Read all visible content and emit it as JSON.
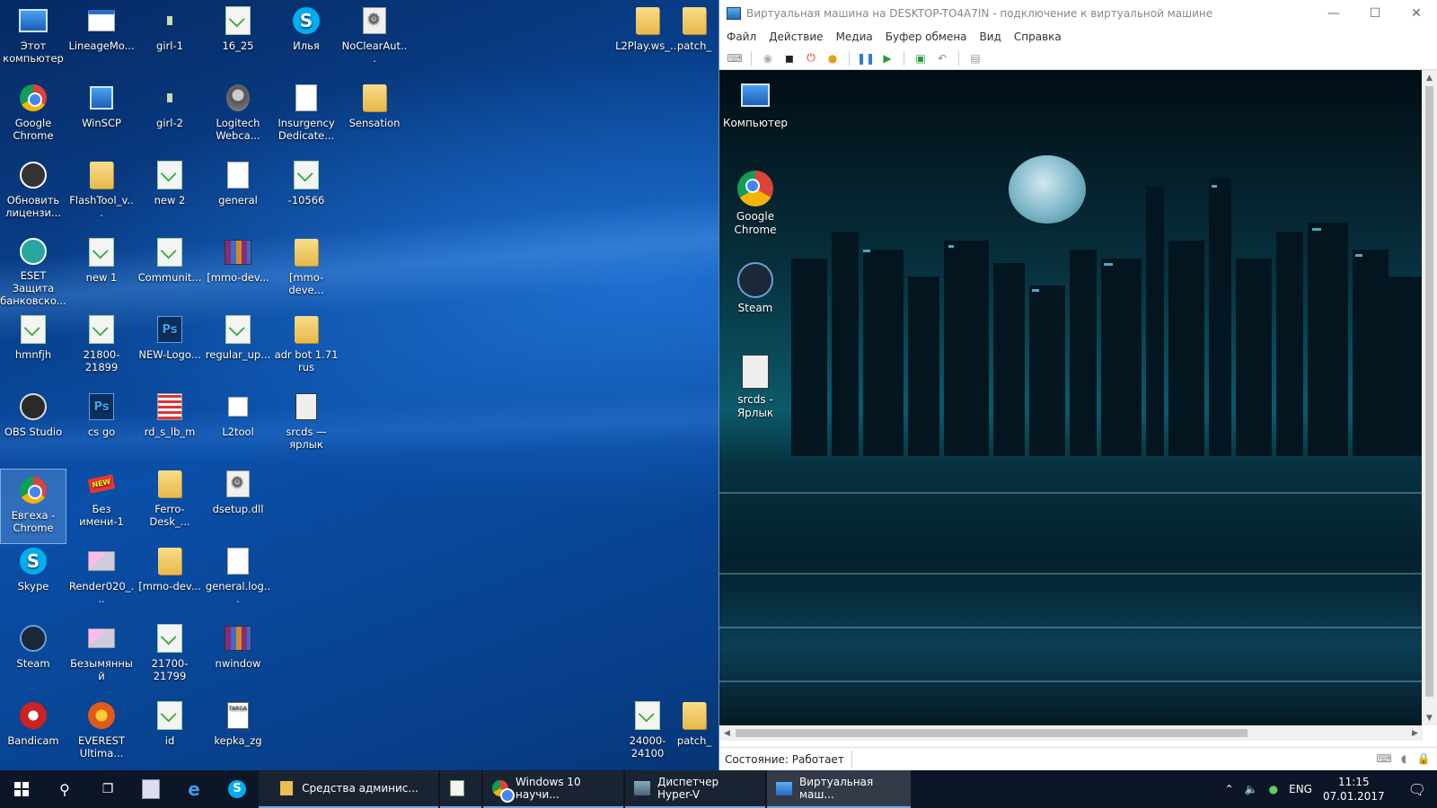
{
  "desktop": {
    "icons": [
      {
        "label": "Этот компьютер",
        "icon": "computer-icon"
      },
      {
        "label": "LineageMo...",
        "icon": "window-icon"
      },
      {
        "label": "girl-1",
        "icon": "image-icon"
      },
      {
        "label": "16_25",
        "icon": "notepadpp-icon"
      },
      {
        "label": "Илья",
        "icon": "skype-icon"
      },
      {
        "label": "NoClearAut...",
        "icon": "settings-file-icon"
      },
      {
        "label": "Google Chrome",
        "icon": "chrome-icon"
      },
      {
        "label": "WinSCP",
        "icon": "winscp-icon"
      },
      {
        "label": "girl-2",
        "icon": "image-icon"
      },
      {
        "label": "Logitech Webca...",
        "icon": "webcam-icon"
      },
      {
        "label": "Insurgency Dedicate...",
        "icon": "document-icon"
      },
      {
        "label": "Sensation",
        "icon": "folder-icon"
      },
      {
        "label": "Обновить лицензи...",
        "icon": "update-icon"
      },
      {
        "label": "FlashTool_v...",
        "icon": "folder-icon"
      },
      {
        "label": "new 2",
        "icon": "notepadpp-icon"
      },
      {
        "label": "general",
        "icon": "document-icon"
      },
      {
        "label": "-10566",
        "icon": "notepadpp-icon"
      },
      {
        "label": "ESET Защита банковско...",
        "icon": "eset-icon"
      },
      {
        "label": "new 1",
        "icon": "notepadpp-icon"
      },
      {
        "label": "Communit...",
        "icon": "notepadpp-icon"
      },
      {
        "label": "[mmo-dev...",
        "icon": "winrar-icon"
      },
      {
        "label": "[mmo-deve...",
        "icon": "folder-icon"
      },
      {
        "label": "hmnfjh",
        "icon": "notepadpp-icon"
      },
      {
        "label": "21800-21899",
        "icon": "notepadpp-icon"
      },
      {
        "label": "NEW-Logo...",
        "icon": "photoshop-icon"
      },
      {
        "label": "regular_up...",
        "icon": "notepadpp-icon"
      },
      {
        "label": "adr bot 1.71 rus",
        "icon": "folder-icon"
      },
      {
        "label": "OBS Studio",
        "icon": "obs-icon"
      },
      {
        "label": "cs go",
        "icon": "photoshop-icon"
      },
      {
        "label": "rd_s_lb_m",
        "icon": "image-icon"
      },
      {
        "label": "L2tool",
        "icon": "shortcut-icon"
      },
      {
        "label": "srcds — ярлык",
        "icon": "srcds-icon"
      },
      {
        "label": "Евгеха - Chrome",
        "icon": "chrome-icon"
      },
      {
        "label": "Без имени-1",
        "icon": "new-badge-icon"
      },
      {
        "label": "Ferro-Desk_...",
        "icon": "folder-icon"
      },
      {
        "label": "dsetup.dll",
        "icon": "settings-file-icon"
      },
      {
        "label": "Skype",
        "icon": "skype-icon"
      },
      {
        "label": "Render020_...",
        "icon": "image-icon"
      },
      {
        "label": "[mmo-dev...",
        "icon": "folder-icon"
      },
      {
        "label": "general.log...",
        "icon": "document-icon"
      },
      {
        "label": "Steam",
        "icon": "steam-icon"
      },
      {
        "label": "Безымянный",
        "icon": "image-icon"
      },
      {
        "label": "21700-21799",
        "icon": "notepadpp-icon"
      },
      {
        "label": "nwindow",
        "icon": "winrar-icon"
      },
      {
        "label": "Bandicam",
        "icon": "bandicam-icon"
      },
      {
        "label": "EVEREST Ultima...",
        "icon": "everest-icon"
      },
      {
        "label": "id",
        "icon": "notepadpp-icon"
      },
      {
        "label": "kepka_zg",
        "icon": "targa-icon"
      },
      {
        "label": "L2Play.ws_...",
        "icon": "folder-icon"
      },
      {
        "label": "patch_",
        "icon": "folder-icon"
      },
      {
        "label": "24000-24100",
        "icon": "notepadpp-icon"
      },
      {
        "label": "patch_",
        "icon": "folder-icon"
      }
    ]
  },
  "vm_window": {
    "title": "Виртуальная машина на DESKTOP-TO4A7IN - подключение к виртуальной машине",
    "menu": [
      "Файл",
      "Действие",
      "Медиа",
      "Буфер обмена",
      "Вид",
      "Справка"
    ],
    "guest_icons": [
      "Компьютер",
      "Google Chrome",
      "Steam",
      "srcds - Ярлык"
    ],
    "status": "Состояние: Работает"
  },
  "taskbar": {
    "apps": [
      {
        "label": "Средства админис...",
        "icon": "folder-icon"
      },
      {
        "label": "",
        "icon": "notepadpp-icon"
      },
      {
        "label": "Windows 10 научи...",
        "icon": "chrome-icon"
      },
      {
        "label": "Диспетчер Hyper-V",
        "icon": "hyperv-icon"
      },
      {
        "label": "Виртуальная маш...",
        "icon": "vm-connect-icon"
      }
    ],
    "language": "ENG",
    "time": "11:15",
    "date": "07.01.2017"
  },
  "colors": {
    "taskbar": "#0c1626",
    "accent": "#6fa8dc",
    "desktop": "#0a4fa8"
  }
}
